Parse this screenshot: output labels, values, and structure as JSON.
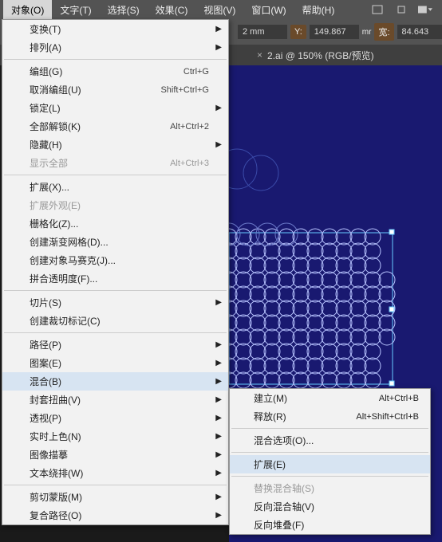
{
  "menubar": {
    "items": [
      "对象(O)",
      "文字(T)",
      "选择(S)",
      "效果(C)",
      "视图(V)",
      "窗口(W)",
      "帮助(H)"
    ]
  },
  "propbar": {
    "mm": "2 mm",
    "y_label": "Y:",
    "y_value": "149.867",
    "w_label": "宽:",
    "w_value": "84.643",
    "unit": "mr"
  },
  "tab": {
    "close": "×",
    "title": "2.ai @ 150% (RGB/预览)"
  },
  "menu": [
    {
      "t": "sub",
      "label": "变换(T)"
    },
    {
      "t": "sub",
      "label": "排列(A)"
    },
    {
      "t": "sep"
    },
    {
      "t": "sc",
      "label": "编组(G)",
      "sc": "Ctrl+G"
    },
    {
      "t": "sc",
      "label": "取消编组(U)",
      "sc": "Shift+Ctrl+G"
    },
    {
      "t": "sub",
      "label": "锁定(L)"
    },
    {
      "t": "sc",
      "label": "全部解锁(K)",
      "sc": "Alt+Ctrl+2"
    },
    {
      "t": "sub",
      "label": "隐藏(H)"
    },
    {
      "t": "sc",
      "label": "显示全部",
      "sc": "Alt+Ctrl+3",
      "dis": true
    },
    {
      "t": "sep"
    },
    {
      "t": "item",
      "label": "扩展(X)..."
    },
    {
      "t": "item",
      "label": "扩展外观(E)",
      "dis": true
    },
    {
      "t": "item",
      "label": "栅格化(Z)..."
    },
    {
      "t": "item",
      "label": "创建渐变网格(D)..."
    },
    {
      "t": "item",
      "label": "创建对象马赛克(J)..."
    },
    {
      "t": "item",
      "label": "拼合透明度(F)..."
    },
    {
      "t": "sep"
    },
    {
      "t": "sub",
      "label": "切片(S)"
    },
    {
      "t": "item",
      "label": "创建裁切标记(C)"
    },
    {
      "t": "sep"
    },
    {
      "t": "sub",
      "label": "路径(P)"
    },
    {
      "t": "sub",
      "label": "图案(E)"
    },
    {
      "t": "sub",
      "label": "混合(B)",
      "sel": true
    },
    {
      "t": "sub",
      "label": "封套扭曲(V)"
    },
    {
      "t": "sub",
      "label": "透视(P)"
    },
    {
      "t": "sub",
      "label": "实时上色(N)"
    },
    {
      "t": "sub",
      "label": "图像描摹"
    },
    {
      "t": "sub",
      "label": "文本绕排(W)"
    },
    {
      "t": "sep"
    },
    {
      "t": "sub",
      "label": "剪切蒙版(M)"
    },
    {
      "t": "sub",
      "label": "复合路径(O)"
    }
  ],
  "submenu": [
    {
      "t": "sc",
      "label": "建立(M)",
      "sc": "Alt+Ctrl+B"
    },
    {
      "t": "sc",
      "label": "释放(R)",
      "sc": "Alt+Shift+Ctrl+B"
    },
    {
      "t": "sep"
    },
    {
      "t": "item",
      "label": "混合选项(O)..."
    },
    {
      "t": "sep"
    },
    {
      "t": "item",
      "label": "扩展(E)",
      "sel": true
    },
    {
      "t": "sep"
    },
    {
      "t": "item",
      "label": "替换混合轴(S)",
      "dis": true
    },
    {
      "t": "item",
      "label": "反向混合轴(V)"
    },
    {
      "t": "item",
      "label": "反向堆叠(F)"
    }
  ]
}
